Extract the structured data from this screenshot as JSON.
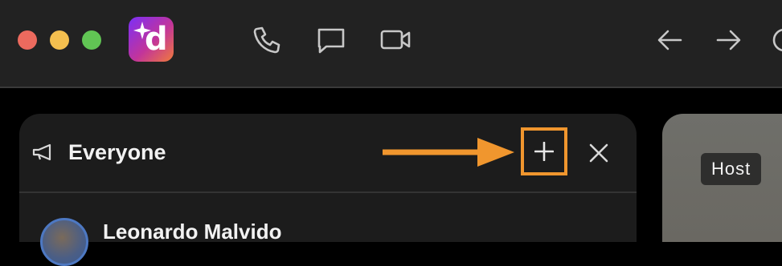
{
  "app": {
    "logo_letter": "d",
    "logo_name": "app-logo"
  },
  "titlebar": {
    "icons": [
      "phone-icon",
      "chat-icon",
      "video-camera-icon",
      "back-arrow-icon",
      "forward-arrow-icon",
      "history-icon"
    ]
  },
  "panel": {
    "title": "Everyone",
    "add_label": "+",
    "close_label": "×",
    "participants": [
      {
        "name": "Leonardo Malvido"
      }
    ]
  },
  "video": {
    "badge": "Host"
  },
  "annotation": {
    "color": "#f0962e",
    "target": "add-button"
  },
  "colors": {
    "titlebar_bg": "#222222",
    "panel_bg": "#1c1c1c",
    "traffic_red": "#ec6a5e",
    "traffic_yellow": "#f4bf4f",
    "traffic_green": "#61c554"
  }
}
